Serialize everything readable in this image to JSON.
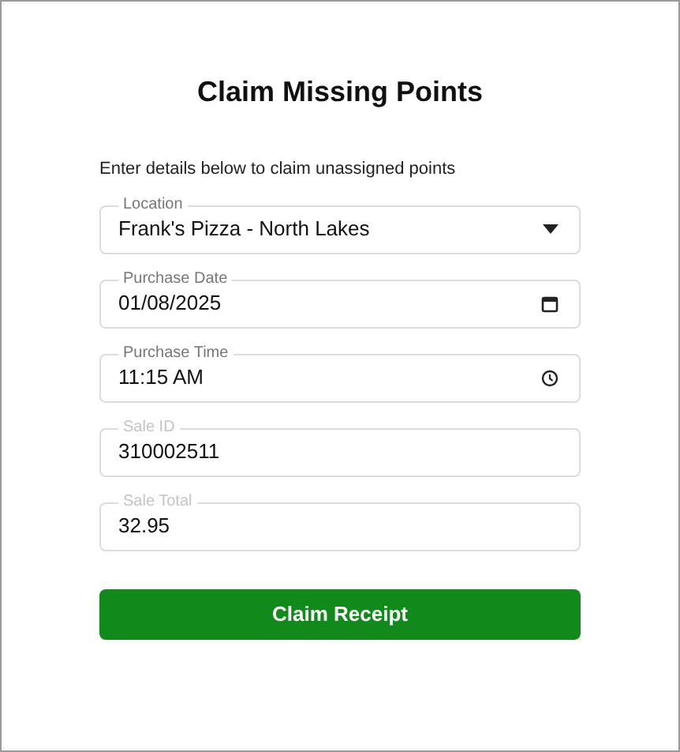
{
  "title": "Claim Missing Points",
  "instructions": "Enter details below to claim unassigned points",
  "fields": [
    {
      "kind": "select",
      "label": "Location",
      "value": "Frank's Pizza - North Lakes",
      "readonly": false
    },
    {
      "kind": "date",
      "label": "Purchase Date",
      "value": "01/08/2025",
      "readonly": false
    },
    {
      "kind": "time",
      "label": "Purchase Time",
      "value": "11:15 AM",
      "readonly": false
    },
    {
      "kind": "text",
      "label": "Sale ID",
      "value": "310002511",
      "readonly": true
    },
    {
      "kind": "text",
      "label": "Sale Total",
      "value": "32.95",
      "readonly": true
    }
  ],
  "button": "Claim Receipt"
}
